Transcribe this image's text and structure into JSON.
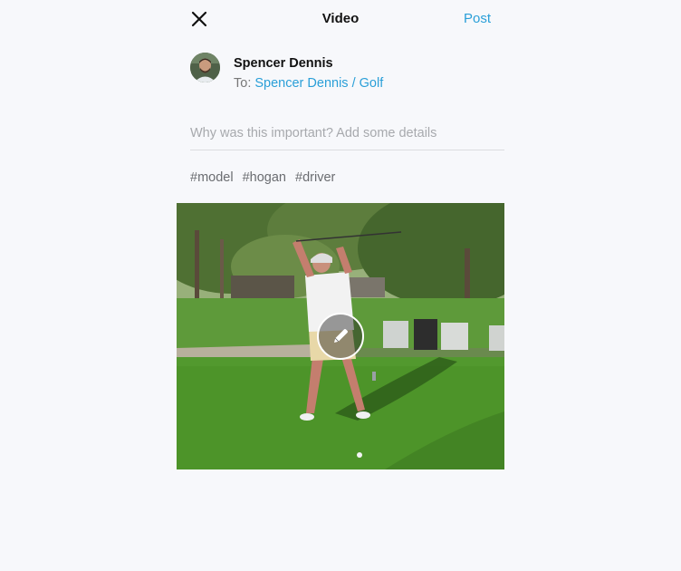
{
  "header": {
    "title": "Video",
    "post_label": "Post"
  },
  "author": {
    "name": "Spencer Dennis",
    "audience_prefix": "To:",
    "audience_target": "Spencer Dennis / Golf"
  },
  "details": {
    "placeholder": "Why was this important? Add some details",
    "value": ""
  },
  "tags": [
    "#model",
    "#hogan",
    "#driver"
  ],
  "icons": {
    "close": "close-icon",
    "edit": "pencil-icon"
  },
  "colors": {
    "accent": "#2a9fd8",
    "background": "#f7f8fb"
  }
}
